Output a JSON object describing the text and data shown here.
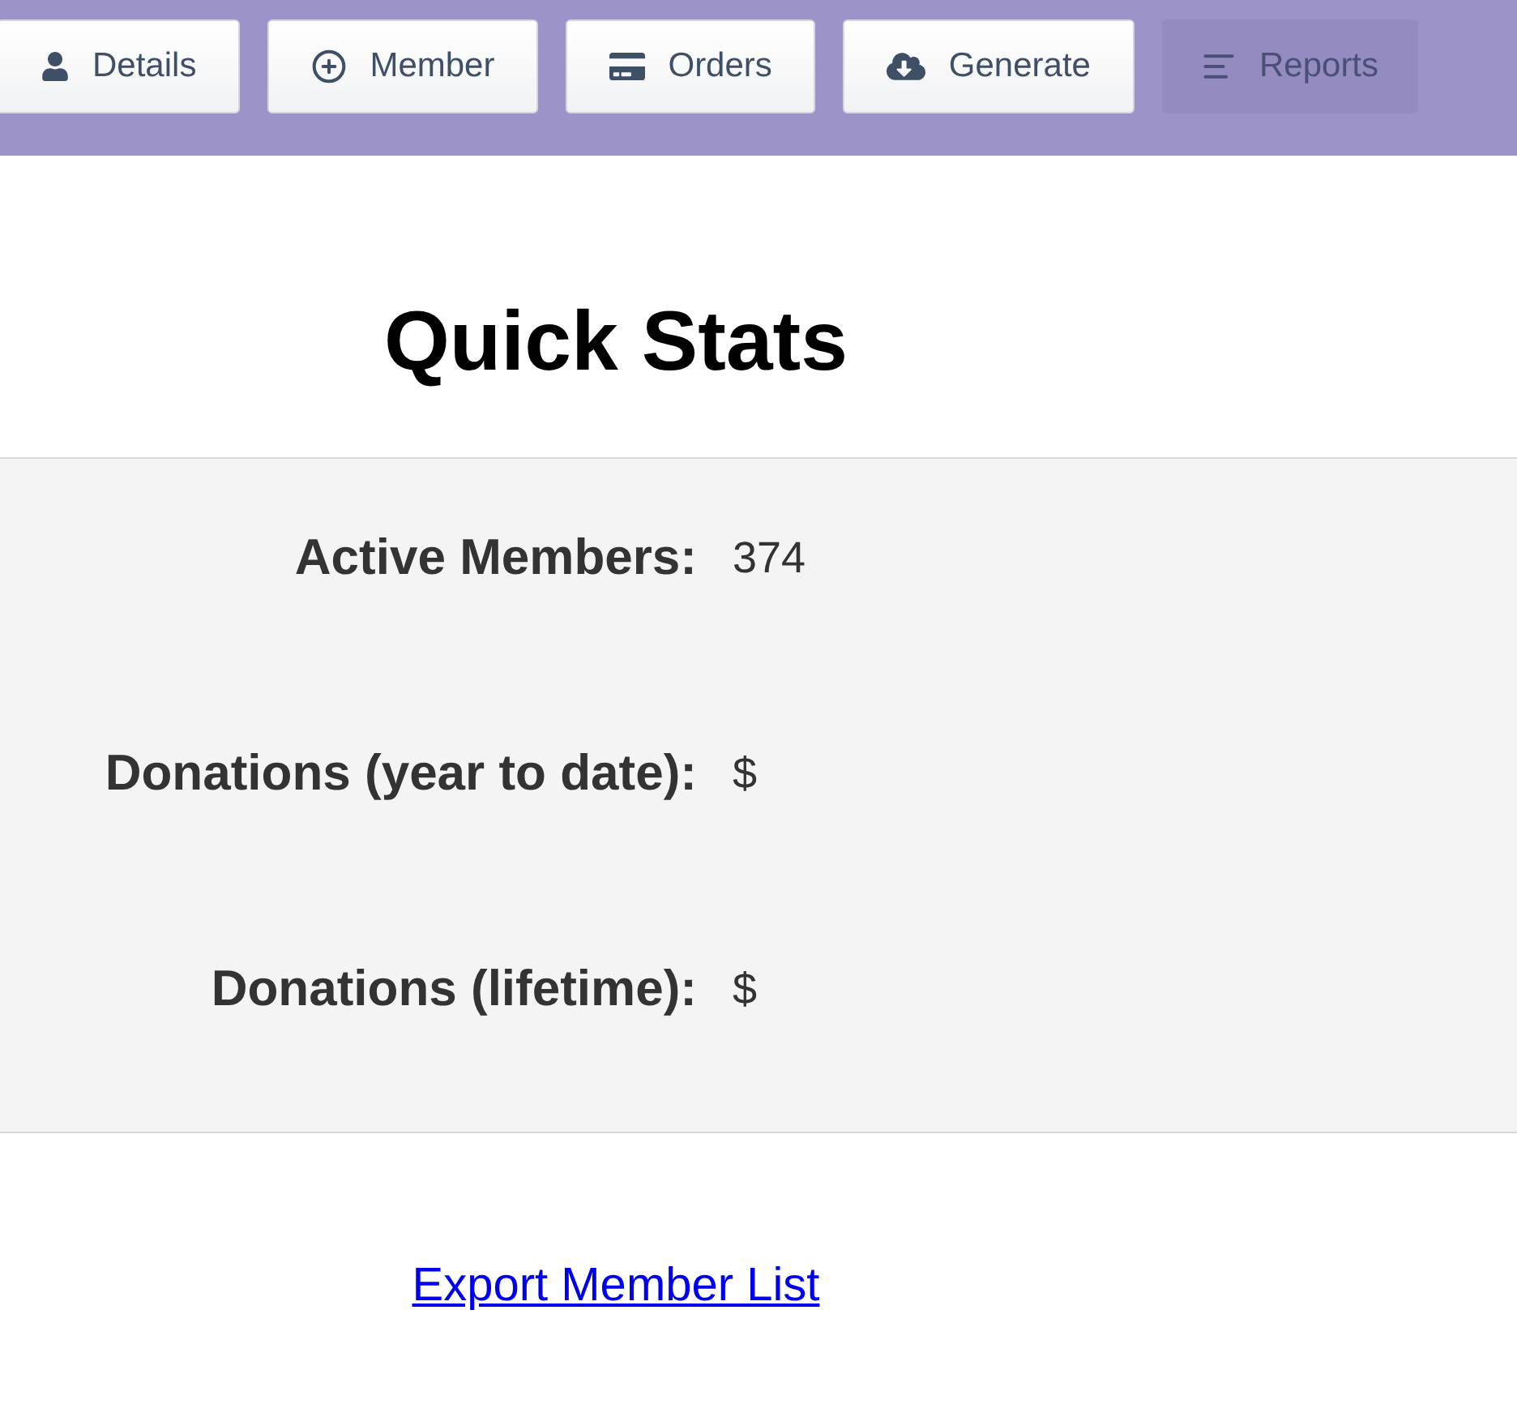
{
  "toolbar": {
    "buttons": [
      {
        "label": "Details",
        "selected": false
      },
      {
        "label": "Member",
        "selected": false
      },
      {
        "label": "Orders",
        "selected": false
      },
      {
        "label": "Generate",
        "selected": false
      },
      {
        "label": "Reports",
        "selected": true
      }
    ]
  },
  "title": "Quick Stats",
  "stats": [
    {
      "label": "Active Members:",
      "value": "374"
    },
    {
      "label": "Donations (year to date):",
      "value": "$"
    },
    {
      "label": "Donations (lifetime):",
      "value": "$"
    }
  ],
  "link": "Export Member List"
}
